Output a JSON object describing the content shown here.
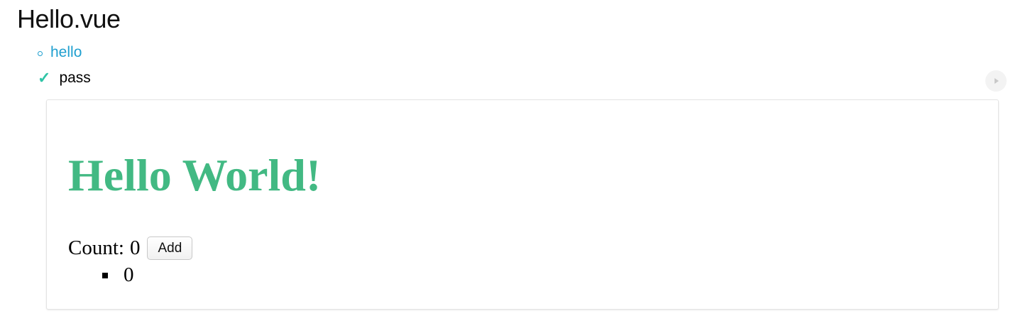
{
  "suite": {
    "title": "Hello.vue"
  },
  "tests": [
    {
      "label": "hello",
      "status_icon": "circle-bullet-icon"
    },
    {
      "label": "pass",
      "status_icon": "check-icon",
      "status_glyph": "✓"
    }
  ],
  "colors": {
    "link": "#1f9fcf",
    "pass": "#2fc4a6",
    "heading": "#42b983"
  },
  "preview": {
    "heading": "Hello World!",
    "count_label": "Count:",
    "count_value": "0",
    "add_button_label": "Add",
    "list_items": [
      "0"
    ]
  },
  "controls": {
    "replay_icon": "play-icon"
  }
}
